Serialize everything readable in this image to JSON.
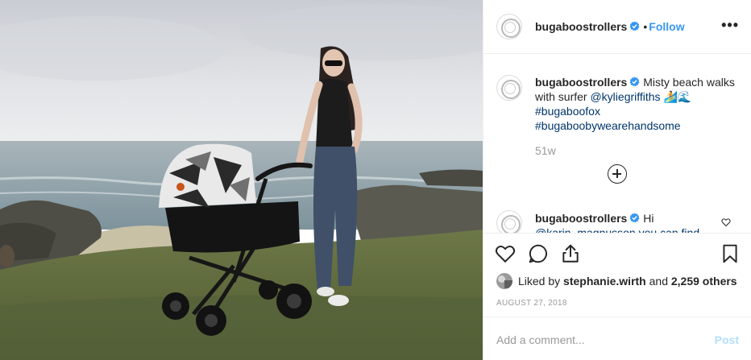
{
  "post": {
    "image_alt": "Woman pushing a Bugaboo Fox stroller on a misty clifftop by the sea",
    "photo_colors": {
      "sky": "#dcdee2",
      "sea": "#8fa3ad",
      "grass": "#5d6a3c",
      "rock": "#5a5a52"
    }
  },
  "header": {
    "username": "bugaboostrollers",
    "separator": "•",
    "follow_label": "Follow",
    "more_label": "•••"
  },
  "caption": {
    "username": "bugaboostrollers",
    "text_part1": "Misty beach walks with surfer",
    "mention": "@kyliegriffiths",
    "emojis": "🏄🌊",
    "hashtag1": "#bugaboofox",
    "hashtag2": "#bugaboobywearehandsome",
    "timestamp": "51w"
  },
  "reply": {
    "username": "bugaboostrollers",
    "text": "Hi",
    "mention_cut": "@karin_magnusson you can find"
  },
  "actions": {
    "icons": [
      "heart-icon",
      "comment-icon",
      "share-icon",
      "bookmark-icon"
    ]
  },
  "likes": {
    "prefix": "Liked by",
    "liker": "stephanie.wirth",
    "middle": "and",
    "others": "2,259 others"
  },
  "date": "AUGUST 27, 2018",
  "comment_box": {
    "placeholder": "Add a comment...",
    "post_label": "Post"
  },
  "colors": {
    "link": "#003569",
    "follow": "#3897f0",
    "verified": "#3897f0",
    "post_disabled": "#b2dffc",
    "muted": "#999999"
  }
}
